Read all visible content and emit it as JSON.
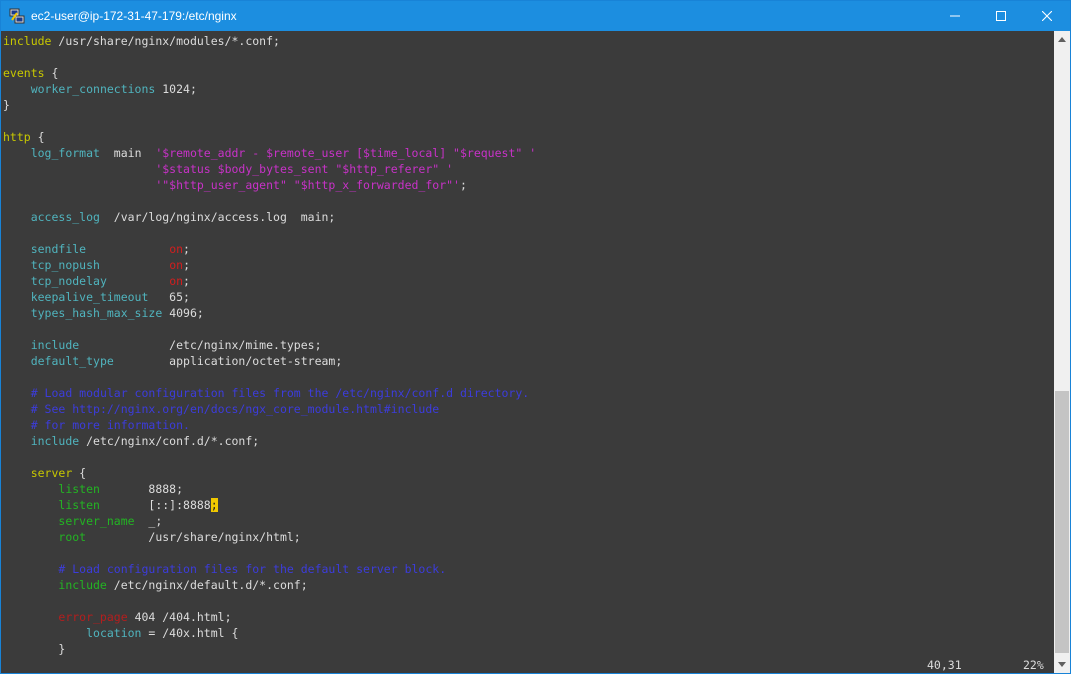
{
  "window": {
    "title": "ec2-user@ip-172-31-47-179:/etc/nginx"
  },
  "lines": [
    [
      [
        "kw",
        "include"
      ],
      [
        "t",
        " /usr/share/nginx/modules/*.conf;"
      ]
    ],
    [],
    [
      [
        "kw",
        "events"
      ],
      [
        "t",
        " {"
      ]
    ],
    [
      [
        "t",
        "    "
      ],
      [
        "dir",
        "worker_connections"
      ],
      [
        "t",
        " 1024;"
      ]
    ],
    [
      [
        "t",
        "}"
      ]
    ],
    [],
    [
      [
        "kw",
        "http"
      ],
      [
        "t",
        " {"
      ]
    ],
    [
      [
        "t",
        "    "
      ],
      [
        "dir",
        "log_format"
      ],
      [
        "t",
        "  main  "
      ],
      [
        "str",
        "'$remote_addr - $remote_user [$time_local] \"$request\" '"
      ]
    ],
    [
      [
        "t",
        "                      "
      ],
      [
        "str",
        "'$status $body_bytes_sent \"$http_referer\" '"
      ]
    ],
    [
      [
        "t",
        "                      "
      ],
      [
        "str",
        "'\"$http_user_agent\" \"$http_x_forwarded_for\"'"
      ],
      [
        "t",
        ";"
      ]
    ],
    [],
    [
      [
        "t",
        "    "
      ],
      [
        "dir",
        "access_log"
      ],
      [
        "t",
        "  /var/log/nginx/access.log  main;"
      ]
    ],
    [],
    [
      [
        "t",
        "    "
      ],
      [
        "dir",
        "sendfile"
      ],
      [
        "t",
        "            "
      ],
      [
        "on",
        "on"
      ],
      [
        "t",
        ";"
      ]
    ],
    [
      [
        "t",
        "    "
      ],
      [
        "dir",
        "tcp_nopush"
      ],
      [
        "t",
        "          "
      ],
      [
        "on",
        "on"
      ],
      [
        "t",
        ";"
      ]
    ],
    [
      [
        "t",
        "    "
      ],
      [
        "dir",
        "tcp_nodelay"
      ],
      [
        "t",
        "         "
      ],
      [
        "on",
        "on"
      ],
      [
        "t",
        ";"
      ]
    ],
    [
      [
        "t",
        "    "
      ],
      [
        "dir",
        "keepalive_timeout"
      ],
      [
        "t",
        "   65;"
      ]
    ],
    [
      [
        "t",
        "    "
      ],
      [
        "dir",
        "types_hash_max_size"
      ],
      [
        "t",
        " 4096;"
      ]
    ],
    [],
    [
      [
        "t",
        "    "
      ],
      [
        "dir",
        "include"
      ],
      [
        "t",
        "             /etc/nginx/mime.types;"
      ]
    ],
    [
      [
        "t",
        "    "
      ],
      [
        "dir",
        "default_type"
      ],
      [
        "t",
        "        application/octet-stream;"
      ]
    ],
    [],
    [
      [
        "t",
        "    "
      ],
      [
        "cmt",
        "# Load modular configuration files from the /etc/nginx/conf.d directory."
      ]
    ],
    [
      [
        "t",
        "    "
      ],
      [
        "cmt",
        "# See http://nginx.org/en/docs/ngx_core_module.html#include"
      ]
    ],
    [
      [
        "t",
        "    "
      ],
      [
        "cmt",
        "# for more information."
      ]
    ],
    [
      [
        "t",
        "    "
      ],
      [
        "dir",
        "include"
      ],
      [
        "t",
        " /etc/nginx/conf.d/*.conf;"
      ]
    ],
    [],
    [
      [
        "t",
        "    "
      ],
      [
        "kw",
        "server"
      ],
      [
        "t",
        " {"
      ]
    ],
    [
      [
        "t",
        "        "
      ],
      [
        "srv",
        "listen"
      ],
      [
        "t",
        "       8888;"
      ]
    ],
    [
      [
        "t",
        "        "
      ],
      [
        "srv",
        "listen"
      ],
      [
        "t",
        "       [::]:8888"
      ],
      [
        "cursor",
        ";"
      ]
    ],
    [
      [
        "t",
        "        "
      ],
      [
        "srv",
        "server_name"
      ],
      [
        "t",
        "  _;"
      ]
    ],
    [
      [
        "t",
        "        "
      ],
      [
        "srv",
        "root"
      ],
      [
        "t",
        "         /usr/share/nginx/html;"
      ]
    ],
    [],
    [
      [
        "t",
        "        "
      ],
      [
        "cmt",
        "# Load configuration files for the default server block."
      ]
    ],
    [
      [
        "t",
        "        "
      ],
      [
        "srv",
        "include"
      ],
      [
        "t",
        " /etc/nginx/default.d/*.conf;"
      ]
    ],
    [],
    [
      [
        "t",
        "        "
      ],
      [
        "err",
        "error_page"
      ],
      [
        "t",
        " 404 /404.html;"
      ]
    ],
    [
      [
        "t",
        "            "
      ],
      [
        "dir",
        "location"
      ],
      [
        "t",
        " = /40x.html {"
      ]
    ],
    [
      [
        "t",
        "        }"
      ]
    ]
  ],
  "status": {
    "position": "40,31",
    "percent": "22%"
  },
  "colors": {
    "titlebar": "#1c8ee0",
    "background": "#3b3b3b",
    "keyword": "#c8c800",
    "directive": "#50b4be",
    "string": "#c832c8",
    "comment": "#3c3cdc"
  },
  "icons": {
    "app": "putty-icon",
    "minimize": "minimize-icon",
    "maximize": "maximize-icon",
    "close": "close-icon"
  }
}
